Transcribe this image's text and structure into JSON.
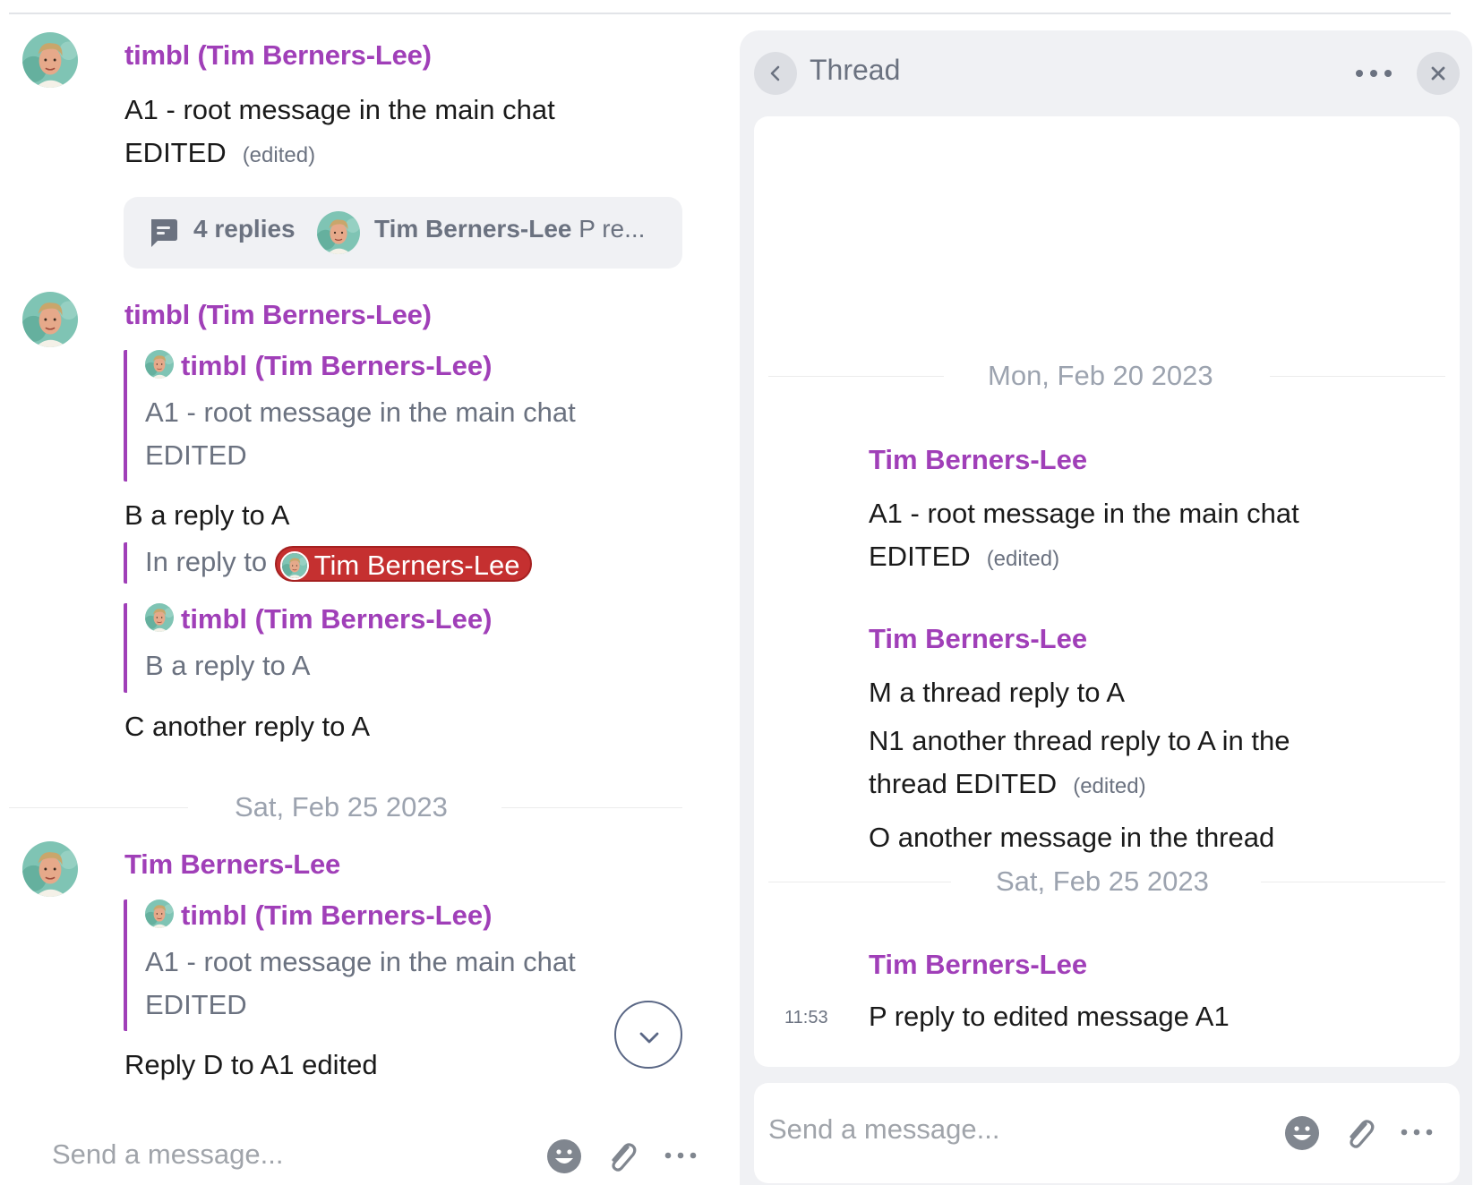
{
  "colors": {
    "author": "#a03fb8",
    "mention_bg": "#c53030",
    "panel_bg": "#f0f1f4",
    "muted_text": "#6b7280"
  },
  "main_chat": {
    "messages": [
      {
        "author": "timbl (Tim Berners-Lee)",
        "avatar": "tim-berners-lee-avatar",
        "lines": [
          "A1 - root message in the main chat",
          "EDITED"
        ],
        "edited_label": "(edited)",
        "replies": {
          "icon": "chat-bubble-icon",
          "count_label": "4 replies",
          "last_author": "Tim Berners-Lee",
          "last_preview": "P re..."
        }
      },
      {
        "author": "timbl (Tim Berners-Lee)",
        "avatar": "tim-berners-lee-avatar",
        "quote_1": {
          "author": "timbl (Tim Berners-Lee)",
          "lines": [
            "A1 - root message in the main chat",
            "EDITED"
          ]
        },
        "text_b": "B a reply to A",
        "in_reply_to": {
          "prefix": "In reply to",
          "mention": "Tim Berners-Lee"
        },
        "quote_2": {
          "author": "timbl (Tim Berners-Lee)",
          "lines": [
            "B a reply to A"
          ]
        },
        "text_c": "C another reply to A"
      },
      {
        "author": "Tim Berners-Lee",
        "avatar": "tim-berners-lee-avatar",
        "quote": {
          "author": "timbl (Tim Berners-Lee)",
          "lines": [
            "A1 - root message in the main chat",
            "EDITED"
          ]
        },
        "text": "Reply D to A1 edited"
      }
    ],
    "date_separator": "Sat, Feb 25 2023",
    "composer": {
      "placeholder": "Send a message...",
      "icons": [
        "emoji-icon",
        "paperclip-icon",
        "more-icon"
      ]
    },
    "scroll_down_icon": "chevron-down-icon"
  },
  "thread_panel": {
    "title": "Thread",
    "header_icons": [
      "chevron-left-icon",
      "more-icon",
      "close-icon"
    ],
    "date_separators": [
      "Mon, Feb 20 2023",
      "Sat, Feb 25 2023"
    ],
    "messages": [
      {
        "author": "Tim Berners-Lee",
        "lines": [
          "A1 - root message in the main chat",
          "EDITED"
        ],
        "edited_label": "(edited)"
      },
      {
        "author": "Tim Berners-Lee",
        "lines": [
          "M a thread reply to A",
          "N1 another thread reply to A in the",
          "thread EDITED",
          "O another message in the thread"
        ],
        "edited_label": "(edited)"
      },
      {
        "author": "Tim Berners-Lee",
        "time": "11:53",
        "lines": [
          "P reply to edited message A1"
        ]
      }
    ],
    "composer": {
      "placeholder": "Send a message...",
      "icons": [
        "emoji-icon",
        "paperclip-icon",
        "more-icon"
      ]
    }
  }
}
